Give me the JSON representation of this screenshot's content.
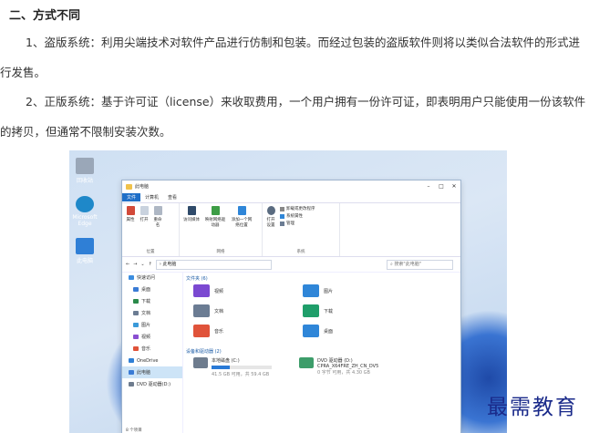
{
  "article": {
    "heading": "二、方式不同",
    "para1": "1、盗版系统：利用尖端技术对软件产品进行仿制和包装。而经过包装的盗版软件则将以类似合法软件的形式进行发售。",
    "para2": "2、正版系统：基于许可证（license）来收取费用，一个用户拥有一份许可证，即表明用户只能使用一份该软件的拷贝，但通常不限制安装次数。"
  },
  "desktop": {
    "icons": [
      {
        "label": "回收站",
        "icon": "recycle-bin-icon",
        "color": "#9aa7b8"
      },
      {
        "label": "Microsoft Edge",
        "icon": "edge-icon",
        "color": "#1e88c9"
      },
      {
        "label": "此电脑",
        "icon": "monitor-icon",
        "color": "#2f7fd6"
      }
    ]
  },
  "explorer": {
    "title": "此电脑",
    "tabs": [
      "文件",
      "计算机",
      "查看"
    ],
    "ribbon": {
      "groups": [
        {
          "label": "位置",
          "buttons": [
            "属性",
            "打开",
            "重命名"
          ]
        },
        {
          "label": "网络",
          "buttons": [
            "访问媒体",
            "映射网络驱动器",
            "添加一个网络位置"
          ]
        },
        {
          "label": "系统",
          "buttons": [
            "打开设置"
          ],
          "list": [
            "卸载或更改程序",
            "系统属性",
            "管理"
          ]
        }
      ]
    },
    "address": {
      "path": "此电脑",
      "search_placeholder": "搜索\"此电脑\""
    },
    "nav": [
      {
        "label": "快速访问",
        "color": "#3b8de0"
      },
      {
        "label": "桌面",
        "color": "#3a7bd5"
      },
      {
        "label": "下载",
        "color": "#2a8a4a"
      },
      {
        "label": "文档",
        "color": "#6b7c93"
      },
      {
        "label": "图片",
        "color": "#3a9ad9"
      },
      {
        "label": "视频",
        "color": "#8a4fd1"
      },
      {
        "label": "音乐",
        "color": "#e0533a"
      },
      {
        "label": "OneDrive",
        "color": "#2f7fd6"
      },
      {
        "label": "此电脑",
        "color": "#3a7bd5"
      },
      {
        "label": "DVD 驱动器(D:)",
        "color": "#6e7c8e"
      }
    ],
    "folders_title": "文件夹 (6)",
    "folders": [
      {
        "label": "视频",
        "color": "#7b49d1"
      },
      {
        "label": "图片",
        "color": "#2f86d8"
      },
      {
        "label": "文档",
        "color": "#6b7c93"
      },
      {
        "label": "下载",
        "color": "#1f9e6a"
      },
      {
        "label": "音乐",
        "color": "#e0533a"
      },
      {
        "label": "桌面",
        "color": "#2f86d8"
      }
    ],
    "devices_title": "设备和驱动器 (2)",
    "drives": [
      {
        "name": "本地磁盘 (C:)",
        "detail": "41.5 GB 可用，共 59.4 GB",
        "used": 0.3
      },
      {
        "name": "DVD 驱动器 (D:)",
        "detail2": "CPRA_X64FRE_ZH_CN_DV5",
        "detail": "0 字节 可用，共 4.30 GB"
      }
    ],
    "status": "8 个项目"
  },
  "watermark": "最需教育"
}
